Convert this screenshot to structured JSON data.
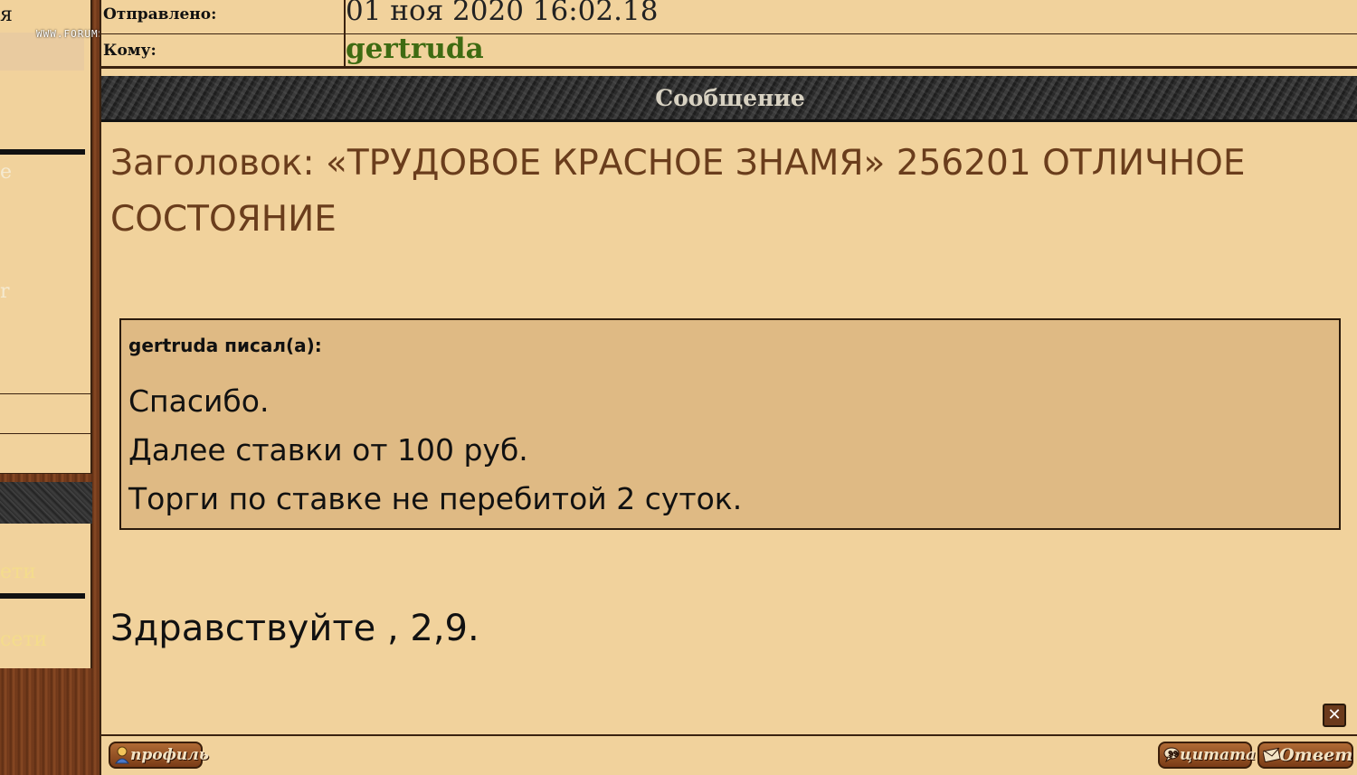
{
  "sidebar": {
    "fragment_top": "я",
    "fragment_mid1": "e",
    "fragment_mid2": "r",
    "fragment_yellow1": "ети",
    "fragment_yellow2": "сети"
  },
  "watermark": "WWW.FORUMS-SU.COM",
  "meta": {
    "sent_label": "Отправлено:",
    "sent_value": "01 ноя 2020 16:02.18",
    "to_label": "Кому:",
    "to_value": "gertruda"
  },
  "section": {
    "title": "Сообщение"
  },
  "message": {
    "subject": "Заголовок: «ТРУДОВОЕ КРАСНОЕ ЗНАМЯ» 256201 ОТЛИЧНОЕ СОСТОЯНИЕ",
    "quote": {
      "author": "gertruda писал(а):",
      "lines": [
        "Спасибо.",
        "Далее ставки от 100 руб.",
        "Торги по ставке не перебитой 2 суток."
      ]
    },
    "body": "Здравствуйте , 2,9."
  },
  "buttons": {
    "profile": "профиль",
    "quote": "цитата",
    "reply": "Ответ",
    "close_symbol": "✕"
  },
  "icons": {
    "profile": "user-icon",
    "quote": "quote-bubble-icon",
    "reply": "envelope-icon",
    "close": "close-icon"
  }
}
